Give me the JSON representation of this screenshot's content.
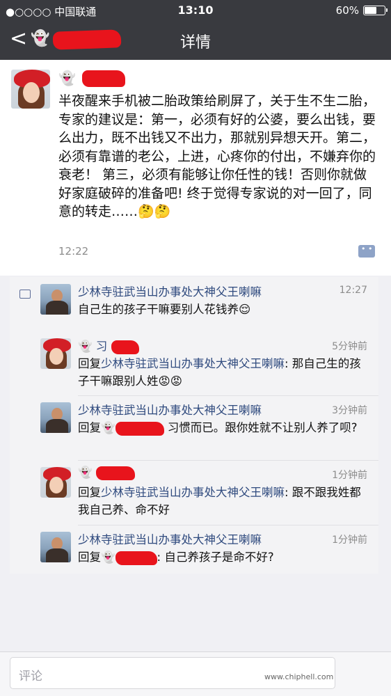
{
  "status_bar": {
    "carrier": "●○○○○ 中国联通",
    "time": "13:10",
    "battery": "60%",
    "battery_level": 0.6
  },
  "nav": {
    "back_label": "<",
    "title": "详情"
  },
  "post": {
    "content": "半夜醒来手机被二胎政策给刷屏了，关于生不生二胎，专家的建议是：第一，必须有好的公婆，要么出钱，要么出力，既不出钱又不出力，那就别异想天开。第二，必须有靠谱的老公，上进，心疼你的付出，不嫌弃你的衰老！ 第三，必须有能够让你任性的钱！否则你就做好家庭破碎的准备吧! 终于觉得专家说的对一回了，同意的转走……",
    "emoji": "🤔🤔",
    "time": "12:22"
  },
  "comments": [
    {
      "author": "少林寺驻武当山办事处大神父王喇嘛",
      "time": "12:27",
      "text": "自己生的孩子干嘛要别人花钱养😌"
    },
    {
      "author_prefix": "习",
      "time": "5分钟前",
      "reply_prefix": "回复",
      "reply_to": "少林寺驻武当山办事处大神父王喇嘛",
      "text": ": 那自己生的孩子干嘛跟别人姓😡😡"
    },
    {
      "author": "少林寺驻武当山办事处大神父王喇嘛",
      "time": "3分钟前",
      "reply_prefix": "回复",
      "text": "习惯而已。跟你姓就不让别人养了呗?"
    },
    {
      "time": "1分钟前",
      "reply_prefix": "回复",
      "reply_to": "少林寺驻武当山办事处大神父王喇嘛",
      "text": ": 跟不跟我姓都我自己养、命不好"
    },
    {
      "author": "少林寺驻武当山办事处大神父王喇嘛",
      "time": "1分钟前",
      "reply_prefix": "回复",
      "text": ": 自己养孩子是命不好?"
    }
  ],
  "input": {
    "placeholder": "评论"
  },
  "watermark": {
    "url": "www.chiphell.com"
  }
}
